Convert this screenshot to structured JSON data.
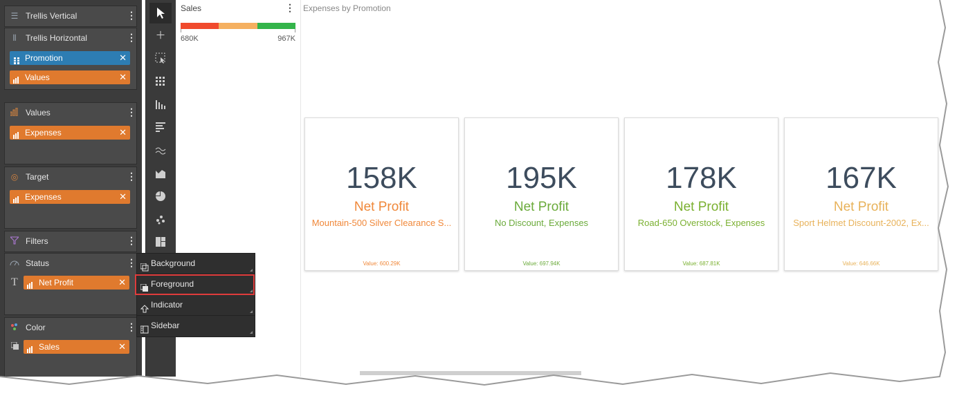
{
  "left_panel": {
    "trellis_vertical": {
      "title": "Trellis Vertical"
    },
    "trellis_horizontal": {
      "title": "Trellis Horizontal",
      "pills": [
        "Promotion",
        "Values"
      ]
    },
    "values": {
      "title": "Values",
      "pills": [
        "Expenses"
      ]
    },
    "target": {
      "title": "Target",
      "pills": [
        "Expenses"
      ]
    },
    "filters": {
      "title": "Filters"
    },
    "status": {
      "title": "Status",
      "pills": [
        "Net Profit"
      ]
    },
    "color": {
      "title": "Color",
      "pills": [
        "Sales"
      ]
    }
  },
  "toolbar": {
    "tools": [
      "pointer-icon",
      "crosshair-icon",
      "marquee-select-icon",
      "grid-icon",
      "column-chart-icon",
      "bar-chart-icon",
      "line-chart-icon",
      "area-chart-icon",
      "pie-chart-icon",
      "scatter-icon",
      "treemap-icon"
    ]
  },
  "menu": {
    "items": [
      "Background",
      "Foreground",
      "Indicator",
      "Sidebar"
    ],
    "selected": "Foreground"
  },
  "sales": {
    "title": "Sales",
    "min_label": "680K",
    "max_label": "967K",
    "segments": [
      "#f04a2d",
      "#f5b060",
      "#33b44a"
    ]
  },
  "main": {
    "title": "Expenses by Promotion",
    "cards": [
      {
        "value": "158K",
        "label": "Net Profit",
        "subtitle": "Mountain-500 Silver Clearance S...",
        "footer": "Value: 600.29K",
        "color": "#f0883a"
      },
      {
        "value": "195K",
        "label": "Net Profit",
        "subtitle": "No Discount, Expenses",
        "footer": "Value: 697.94K",
        "color": "#6aaa3a"
      },
      {
        "value": "178K",
        "label": "Net Profit",
        "subtitle": "Road-650 Overstock, Expenses",
        "footer": "Value: 687.81K",
        "color": "#7ab030"
      },
      {
        "value": "167K",
        "label": "Net Profit",
        "subtitle": "Sport Helmet Discount-2002, Ex...",
        "footer": "Value: 646.66K",
        "color": "#e8b25a"
      }
    ]
  }
}
